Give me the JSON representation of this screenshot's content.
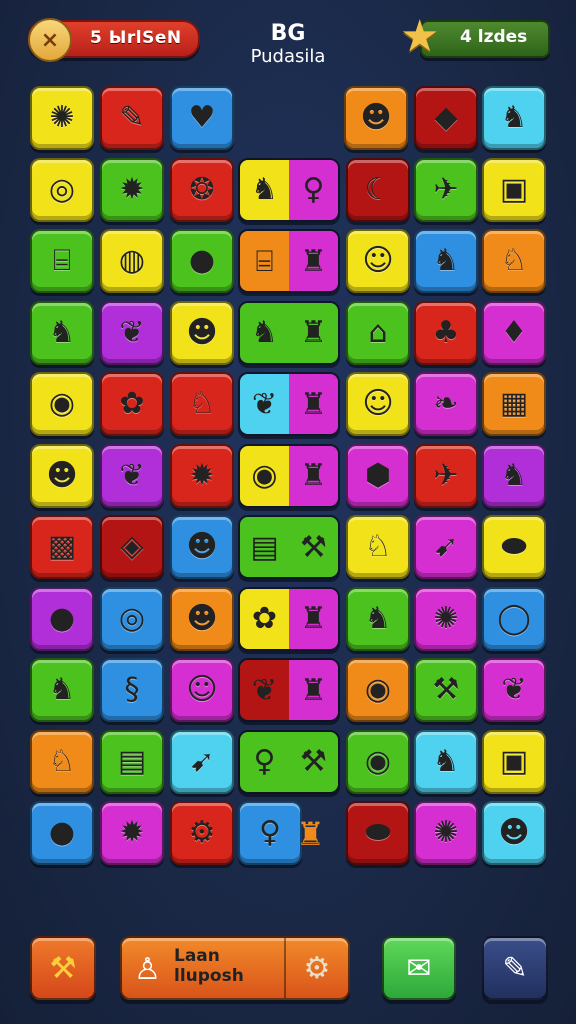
{
  "header": {
    "close_label": "5 ЫrlSeN",
    "close_icon": "×",
    "title": "BG",
    "subtitle": "Pudasila",
    "score_label": "4 lzdes",
    "star_icon": "★"
  },
  "footer": {
    "hammer_icon": "⚒",
    "learn_line1": "Laan",
    "learn_line2": "lluposh",
    "person_icon": "♙",
    "gear_icon": "⚙",
    "mail_icon": "✉",
    "edit_icon": "✎"
  },
  "colors": {
    "yellow": "#f2e21a",
    "red": "#d9261c",
    "blue": "#2f8fe0",
    "orange": "#f08a18",
    "green": "#4cc21f",
    "purple": "#b02fd8",
    "magenta": "#d52fd1",
    "cyan": "#4fd2ef",
    "darkred": "#b31414"
  },
  "tiles": [
    {
      "r": 0,
      "c": 0,
      "color": "yellow",
      "icon": "✺"
    },
    {
      "r": 0,
      "c": 1,
      "color": "red",
      "icon": "✎"
    },
    {
      "r": 0,
      "c": 2,
      "color": "blue",
      "icon": "♥"
    },
    {
      "r": 0,
      "c": 4,
      "color": "orange",
      "icon": "☻"
    },
    {
      "r": 0,
      "c": 5,
      "color": "darkred",
      "icon": "◆"
    },
    {
      "r": 0,
      "c": 6,
      "color": "cyan",
      "icon": "♞"
    },
    {
      "r": 1,
      "c": 0,
      "color": "yellow",
      "icon": "◎"
    },
    {
      "r": 1,
      "c": 1,
      "color": "green",
      "icon": "✹"
    },
    {
      "r": 1,
      "c": 2,
      "color": "red",
      "icon": "❂"
    },
    {
      "r": 1,
      "c": 5,
      "color": "darkred",
      "icon": "☾"
    },
    {
      "r": 1,
      "c": 6,
      "color": "green",
      "icon": "✈"
    },
    {
      "r": 1,
      "c": 7,
      "color": "yellow",
      "icon": "▣"
    },
    {
      "r": 2,
      "c": 0,
      "color": "green",
      "icon": "⌸"
    },
    {
      "r": 2,
      "c": 1,
      "color": "yellow",
      "icon": "◍"
    },
    {
      "r": 2,
      "c": 2,
      "color": "green",
      "icon": "●"
    },
    {
      "r": 2,
      "c": 4,
      "color": "yellow",
      "icon": "☺"
    },
    {
      "r": 2,
      "c": 5,
      "color": "blue",
      "icon": "♞"
    },
    {
      "r": 2,
      "c": 6,
      "color": "orange",
      "icon": "♘"
    },
    {
      "r": 3,
      "c": 0,
      "color": "green",
      "icon": "♞"
    },
    {
      "r": 3,
      "c": 1,
      "color": "purple",
      "icon": "❦"
    },
    {
      "r": 3,
      "c": 2,
      "color": "yellow",
      "icon": "☻"
    },
    {
      "r": 3,
      "c": 4,
      "color": "green",
      "icon": "⌂"
    },
    {
      "r": 3,
      "c": 5,
      "color": "red",
      "icon": "♣"
    },
    {
      "r": 3,
      "c": 6,
      "color": "magenta",
      "icon": "♦"
    },
    {
      "r": 4,
      "c": 0,
      "color": "yellow",
      "icon": "◉"
    },
    {
      "r": 4,
      "c": 1,
      "color": "red",
      "icon": "✿"
    },
    {
      "r": 4,
      "c": 2,
      "color": "red",
      "icon": "♘"
    },
    {
      "r": 4,
      "c": 4,
      "color": "yellow",
      "icon": "☺"
    },
    {
      "r": 4,
      "c": 5,
      "color": "magenta",
      "icon": "❧"
    },
    {
      "r": 4,
      "c": 6,
      "color": "orange",
      "icon": "▦"
    },
    {
      "r": 5,
      "c": 0,
      "color": "yellow",
      "icon": "☻"
    },
    {
      "r": 5,
      "c": 1,
      "color": "purple",
      "icon": "❦"
    },
    {
      "r": 5,
      "c": 2,
      "color": "red",
      "icon": "✹"
    },
    {
      "r": 5,
      "c": 4,
      "color": "magenta",
      "icon": "⬢"
    },
    {
      "r": 5,
      "c": 5,
      "color": "red",
      "icon": "✈"
    },
    {
      "r": 5,
      "c": 6,
      "color": "purple",
      "icon": "♞"
    },
    {
      "r": 6,
      "c": 0,
      "color": "red",
      "icon": "▩"
    },
    {
      "r": 6,
      "c": 1,
      "color": "darkred",
      "icon": "◈"
    },
    {
      "r": 6,
      "c": 2,
      "color": "blue",
      "icon": "☻"
    },
    {
      "r": 6,
      "c": 4,
      "color": "yellow",
      "icon": "♘"
    },
    {
      "r": 6,
      "c": 5,
      "color": "magenta",
      "icon": "➹"
    },
    {
      "r": 6,
      "c": 6,
      "color": "yellow",
      "icon": "⬬"
    },
    {
      "r": 7,
      "c": 0,
      "color": "purple",
      "icon": "●"
    },
    {
      "r": 7,
      "c": 1,
      "color": "blue",
      "icon": "◎"
    },
    {
      "r": 7,
      "c": 2,
      "color": "orange",
      "icon": "☻"
    },
    {
      "r": 7,
      "c": 4,
      "color": "green",
      "icon": "♞"
    },
    {
      "r": 7,
      "c": 5,
      "color": "magenta",
      "icon": "✺"
    },
    {
      "r": 7,
      "c": 6,
      "color": "blue",
      "icon": "◯"
    },
    {
      "r": 8,
      "c": 0,
      "color": "green",
      "icon": "♞"
    },
    {
      "r": 8,
      "c": 1,
      "color": "blue",
      "icon": "§"
    },
    {
      "r": 8,
      "c": 2,
      "color": "magenta",
      "icon": "☺"
    },
    {
      "r": 8,
      "c": 4,
      "color": "orange",
      "icon": "◉"
    },
    {
      "r": 8,
      "c": 5,
      "color": "green",
      "icon": "⚒"
    },
    {
      "r": 8,
      "c": 6,
      "color": "magenta",
      "icon": "❦"
    },
    {
      "r": 9,
      "c": 0,
      "color": "orange",
      "icon": "♘"
    },
    {
      "r": 9,
      "c": 1,
      "color": "green",
      "icon": "▤"
    },
    {
      "r": 9,
      "c": 2,
      "color": "cyan",
      "icon": "➹"
    },
    {
      "r": 9,
      "c": 4,
      "color": "green",
      "icon": "◉"
    },
    {
      "r": 9,
      "c": 5,
      "color": "cyan",
      "icon": "♞"
    },
    {
      "r": 9,
      "c": 6,
      "color": "yellow",
      "icon": "▣"
    },
    {
      "r": 10,
      "c": 0,
      "color": "blue",
      "icon": "●"
    },
    {
      "r": 10,
      "c": 1,
      "color": "magenta",
      "icon": "✹"
    },
    {
      "r": 10,
      "c": 2,
      "color": "red",
      "icon": "⚙"
    },
    {
      "r": 10,
      "c": 3,
      "color": "blue",
      "icon": "♀"
    },
    {
      "r": 10,
      "c": 5,
      "color": "darkred",
      "icon": "⬬"
    },
    {
      "r": 10,
      "c": 6,
      "color": "magenta",
      "icon": "✺"
    },
    {
      "r": 10,
      "c": 7,
      "color": "cyan",
      "icon": "☻"
    }
  ],
  "wides": [
    {
      "r": 1,
      "c": 3,
      "left": "yellow",
      "right": "magenta",
      "icons": [
        "♞",
        "♀"
      ]
    },
    {
      "r": 2,
      "c": 3,
      "left": "orange",
      "right": "magenta",
      "icons": [
        "⌸",
        "♜"
      ]
    },
    {
      "r": 3,
      "c": 3,
      "left": "green",
      "right": "green",
      "icons": [
        "♞",
        "♜"
      ]
    },
    {
      "r": 4,
      "c": 3,
      "left": "cyan",
      "right": "magenta",
      "icons": [
        "❦",
        "♜"
      ]
    },
    {
      "r": 5,
      "c": 3,
      "left": "yellow",
      "right": "magenta",
      "icons": [
        "◉",
        "♜"
      ]
    },
    {
      "r": 6,
      "c": 3,
      "left": "green",
      "right": "green",
      "icons": [
        "▤",
        "⚒"
      ]
    },
    {
      "r": 7,
      "c": 3,
      "left": "yellow",
      "right": "magenta",
      "icons": [
        "✿",
        "♜"
      ]
    },
    {
      "r": 8,
      "c": 3,
      "left": "darkred",
      "right": "magenta",
      "icons": [
        "❦",
        "♜"
      ]
    },
    {
      "r": 9,
      "c": 3,
      "left": "green",
      "right": "green",
      "icons": [
        "♀",
        "⚒"
      ]
    }
  ],
  "loose": [
    {
      "r": 10,
      "c": 4,
      "icon": "♜",
      "color": "#f08a18"
    }
  ]
}
